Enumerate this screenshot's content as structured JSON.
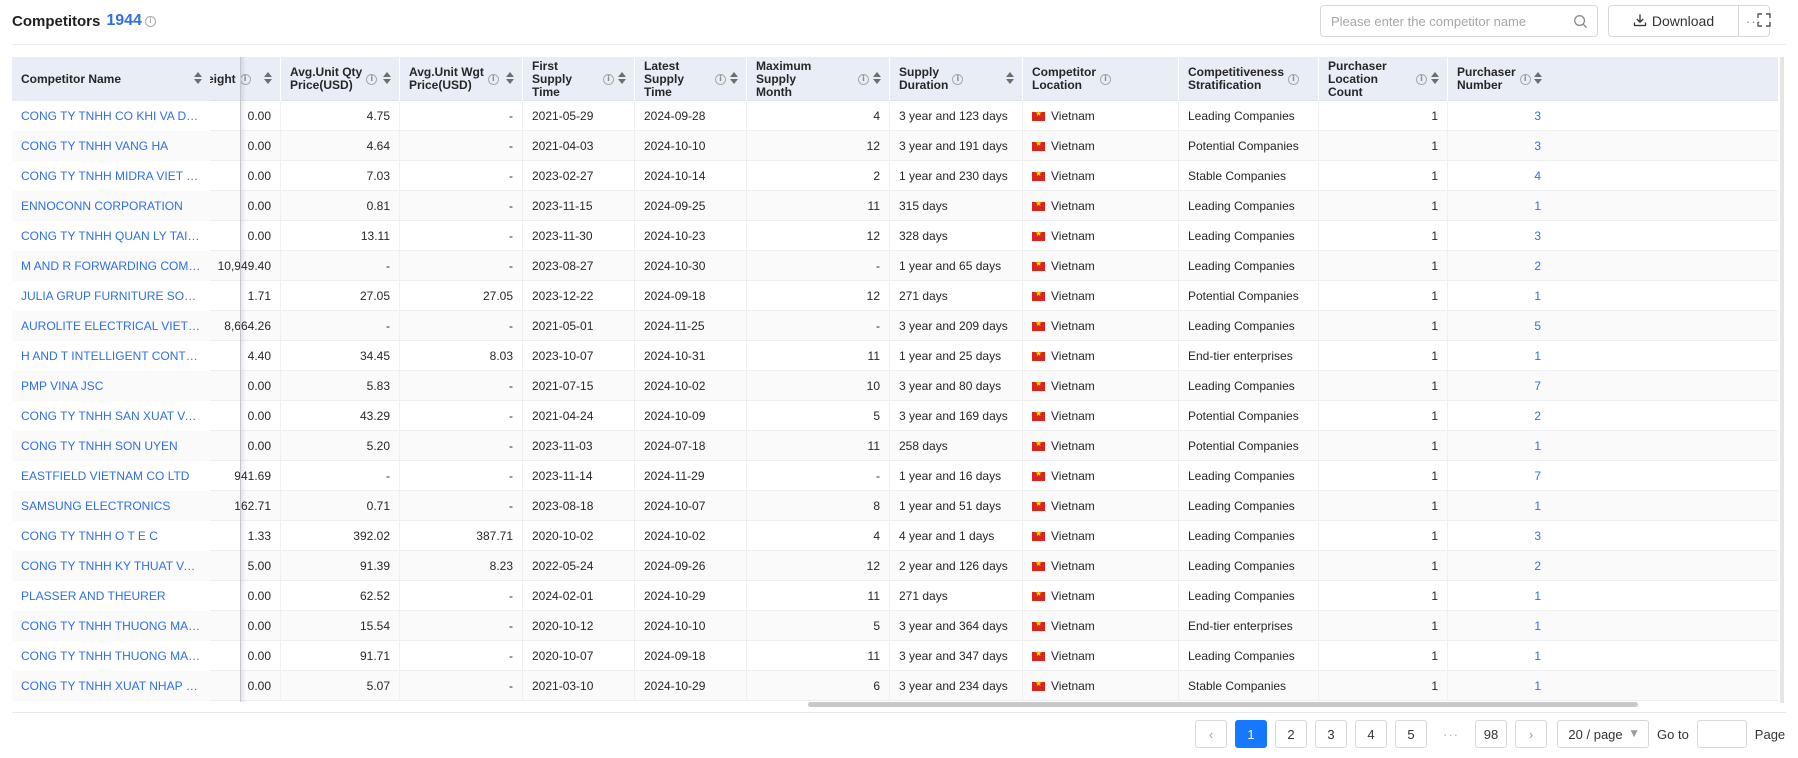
{
  "header": {
    "title": "Competitors",
    "count": "1944",
    "search_placeholder": "Please enter the competitor name",
    "download_label": "Download",
    "more_label": "···"
  },
  "columns": [
    {
      "label_1": "Competitor Name",
      "label_2": "",
      "info": false
    },
    {
      "label_1": "eight",
      "label_2": "",
      "info": true
    },
    {
      "label_1": "Avg.Unit Qty",
      "label_2": "Price(USD)",
      "info": true
    },
    {
      "label_1": "Avg.Unit Wgt",
      "label_2": "Price(USD)",
      "info": true
    },
    {
      "label_1": "First Supply",
      "label_2": "Time",
      "info": true
    },
    {
      "label_1": "Latest Supply",
      "label_2": "Time",
      "info": true
    },
    {
      "label_1": "Maximum Supply",
      "label_2": "Month",
      "info": true
    },
    {
      "label_1": "Supply",
      "label_2": "Duration",
      "info": true
    },
    {
      "label_1": "Competitor",
      "label_2": "Location",
      "info": true
    },
    {
      "label_1": "Competitiveness",
      "label_2": "Stratification",
      "info": true
    },
    {
      "label_1": "Purchaser",
      "label_2": "Location Count",
      "info": true
    },
    {
      "label_1": "Purchaser",
      "label_2": "Number",
      "info": true
    }
  ],
  "rows": [
    {
      "name": "CONG TY TNHH CO KHI VA DICH VU ...",
      "weight": "0.00",
      "qty_price": "4.75",
      "wgt_price": "-",
      "first": "2021-05-29",
      "latest": "2024-09-28",
      "max_month": "4",
      "duration": "3 year and 123 days",
      "location": "Vietnam",
      "strat": "Leading Companies",
      "loc_count": "1",
      "purchasers": "3"
    },
    {
      "name": "CONG TY TNHH VANG HA",
      "weight": "0.00",
      "qty_price": "4.64",
      "wgt_price": "-",
      "first": "2021-04-03",
      "latest": "2024-10-10",
      "max_month": "12",
      "duration": "3 year and 191 days",
      "location": "Vietnam",
      "strat": "Potential Companies",
      "loc_count": "1",
      "purchasers": "3"
    },
    {
      "name": "CONG TY TNHH MIDRA VIET NAM",
      "weight": "0.00",
      "qty_price": "7.03",
      "wgt_price": "-",
      "first": "2023-02-27",
      "latest": "2024-10-14",
      "max_month": "2",
      "duration": "1 year and 230 days",
      "location": "Vietnam",
      "strat": "Stable Companies",
      "loc_count": "1",
      "purchasers": "4"
    },
    {
      "name": "ENNOCONN CORPORATION",
      "weight": "0.00",
      "qty_price": "0.81",
      "wgt_price": "-",
      "first": "2023-11-15",
      "latest": "2024-09-25",
      "max_month": "11",
      "duration": "315 days",
      "location": "Vietnam",
      "strat": "Leading Companies",
      "loc_count": "1",
      "purchasers": "1"
    },
    {
      "name": "CONG TY TNHH QUAN LY TAI SAN TA...",
      "weight": "0.00",
      "qty_price": "13.11",
      "wgt_price": "-",
      "first": "2023-11-30",
      "latest": "2024-10-23",
      "max_month": "12",
      "duration": "328 days",
      "location": "Vietnam",
      "strat": "Leading Companies",
      "loc_count": "1",
      "purchasers": "3"
    },
    {
      "name": "M AND R FORWARDING COMPANY LI...",
      "weight": "10,949.40",
      "qty_price": "-",
      "wgt_price": "-",
      "first": "2023-08-27",
      "latest": "2024-10-30",
      "max_month": "-",
      "duration": "1 year and 65 days",
      "location": "Vietnam",
      "strat": "Leading Companies",
      "loc_count": "1",
      "purchasers": "2"
    },
    {
      "name": "JULIA GRUP FURNITURE SOLUTIONS ...",
      "weight": "1.71",
      "qty_price": "27.05",
      "wgt_price": "27.05",
      "first": "2023-12-22",
      "latest": "2024-09-18",
      "max_month": "12",
      "duration": "271 days",
      "location": "Vietnam",
      "strat": "Potential Companies",
      "loc_count": "1",
      "purchasers": "1"
    },
    {
      "name": "AUROLITE ELECTRICAL VIETNAM CO ...",
      "weight": "8,664.26",
      "qty_price": "-",
      "wgt_price": "-",
      "first": "2021-05-01",
      "latest": "2024-11-25",
      "max_month": "-",
      "duration": "3 year and 209 days",
      "location": "Vietnam",
      "strat": "Leading Companies",
      "loc_count": "1",
      "purchasers": "5"
    },
    {
      "name": "H AND T INTELLIGENT CONTROL INT...",
      "weight": "4.40",
      "qty_price": "34.45",
      "wgt_price": "8.03",
      "first": "2023-10-07",
      "latest": "2024-10-31",
      "max_month": "11",
      "duration": "1 year and 25 days",
      "location": "Vietnam",
      "strat": "End-tier enterprises",
      "loc_count": "1",
      "purchasers": "1"
    },
    {
      "name": "PMP VINA JSC",
      "weight": "0.00",
      "qty_price": "5.83",
      "wgt_price": "-",
      "first": "2021-07-15",
      "latest": "2024-10-02",
      "max_month": "10",
      "duration": "3 year and 80 days",
      "location": "Vietnam",
      "strat": "Leading Companies",
      "loc_count": "1",
      "purchasers": "7"
    },
    {
      "name": "CONG TY TNHH SAN XUAT VA THUO...",
      "weight": "0.00",
      "qty_price": "43.29",
      "wgt_price": "-",
      "first": "2021-04-24",
      "latest": "2024-10-09",
      "max_month": "5",
      "duration": "3 year and 169 days",
      "location": "Vietnam",
      "strat": "Potential Companies",
      "loc_count": "1",
      "purchasers": "2"
    },
    {
      "name": "CONG TY TNHH SON UYEN",
      "weight": "0.00",
      "qty_price": "5.20",
      "wgt_price": "-",
      "first": "2023-11-03",
      "latest": "2024-07-18",
      "max_month": "11",
      "duration": "258 days",
      "location": "Vietnam",
      "strat": "Potential Companies",
      "loc_count": "1",
      "purchasers": "1"
    },
    {
      "name": "EASTFIELD VIETNAM CO LTD",
      "weight": "941.69",
      "qty_price": "-",
      "wgt_price": "-",
      "first": "2023-11-14",
      "latest": "2024-11-29",
      "max_month": "-",
      "duration": "1 year and 16 days",
      "location": "Vietnam",
      "strat": "Leading Companies",
      "loc_count": "1",
      "purchasers": "7"
    },
    {
      "name": "SAMSUNG ELECTRONICS",
      "weight": "162.71",
      "qty_price": "0.71",
      "wgt_price": "-",
      "first": "2023-08-18",
      "latest": "2024-10-07",
      "max_month": "8",
      "duration": "1 year and 51 days",
      "location": "Vietnam",
      "strat": "Leading Companies",
      "loc_count": "1",
      "purchasers": "1"
    },
    {
      "name": "CONG TY TNHH O T E C",
      "weight": "1.33",
      "qty_price": "392.02",
      "wgt_price": "387.71",
      "first": "2020-10-02",
      "latest": "2024-10-02",
      "max_month": "4",
      "duration": "4 year and 1 days",
      "location": "Vietnam",
      "strat": "Leading Companies",
      "loc_count": "1",
      "purchasers": "3"
    },
    {
      "name": "CONG TY TNHH KY THUAT VA XAY D...",
      "weight": "5.00",
      "qty_price": "91.39",
      "wgt_price": "8.23",
      "first": "2022-05-24",
      "latest": "2024-09-26",
      "max_month": "12",
      "duration": "2 year and 126 days",
      "location": "Vietnam",
      "strat": "Leading Companies",
      "loc_count": "1",
      "purchasers": "2"
    },
    {
      "name": "PLASSER AND THEURER",
      "weight": "0.00",
      "qty_price": "62.52",
      "wgt_price": "-",
      "first": "2024-02-01",
      "latest": "2024-10-29",
      "max_month": "11",
      "duration": "271 days",
      "location": "Vietnam",
      "strat": "Leading Companies",
      "loc_count": "1",
      "purchasers": "1"
    },
    {
      "name": "CONG TY TNHH THUONG MAI XUAT ...",
      "weight": "0.00",
      "qty_price": "15.54",
      "wgt_price": "-",
      "first": "2020-10-12",
      "latest": "2024-10-10",
      "max_month": "5",
      "duration": "3 year and 364 days",
      "location": "Vietnam",
      "strat": "End-tier enterprises",
      "loc_count": "1",
      "purchasers": "1"
    },
    {
      "name": "CONG TY TNHH THUONG MAI DICH V...",
      "weight": "0.00",
      "qty_price": "91.71",
      "wgt_price": "-",
      "first": "2020-10-07",
      "latest": "2024-09-18",
      "max_month": "11",
      "duration": "3 year and 347 days",
      "location": "Vietnam",
      "strat": "Leading Companies",
      "loc_count": "1",
      "purchasers": "1"
    },
    {
      "name": "CONG TY TNHH XUAT NHAP KHAU T...",
      "weight": "0.00",
      "qty_price": "5.07",
      "wgt_price": "-",
      "first": "2021-03-10",
      "latest": "2024-10-29",
      "max_month": "6",
      "duration": "3 year and 234 days",
      "location": "Vietnam",
      "strat": "Stable Companies",
      "loc_count": "1",
      "purchasers": "1"
    }
  ],
  "pagination": {
    "prev": "‹",
    "next": "›",
    "pages": [
      "1",
      "2",
      "3",
      "4",
      "5"
    ],
    "ellipsis": "···",
    "last": "98",
    "current": "1",
    "page_size": "20 / page",
    "goto_label": "Go to",
    "page_label": "Page"
  },
  "icons": {
    "search": "search-icon",
    "download": "download-icon",
    "fullscreen": "fullscreen-icon",
    "flag": "vietnam-flag-icon",
    "info": "info-icon",
    "sort": "sort-icon"
  },
  "colors": {
    "accent": "#2f6fe6",
    "primary_button": "#1677ff",
    "header_bg": "#e9edf6",
    "flag_red": "#da251d",
    "flag_star": "#ffdf00"
  }
}
